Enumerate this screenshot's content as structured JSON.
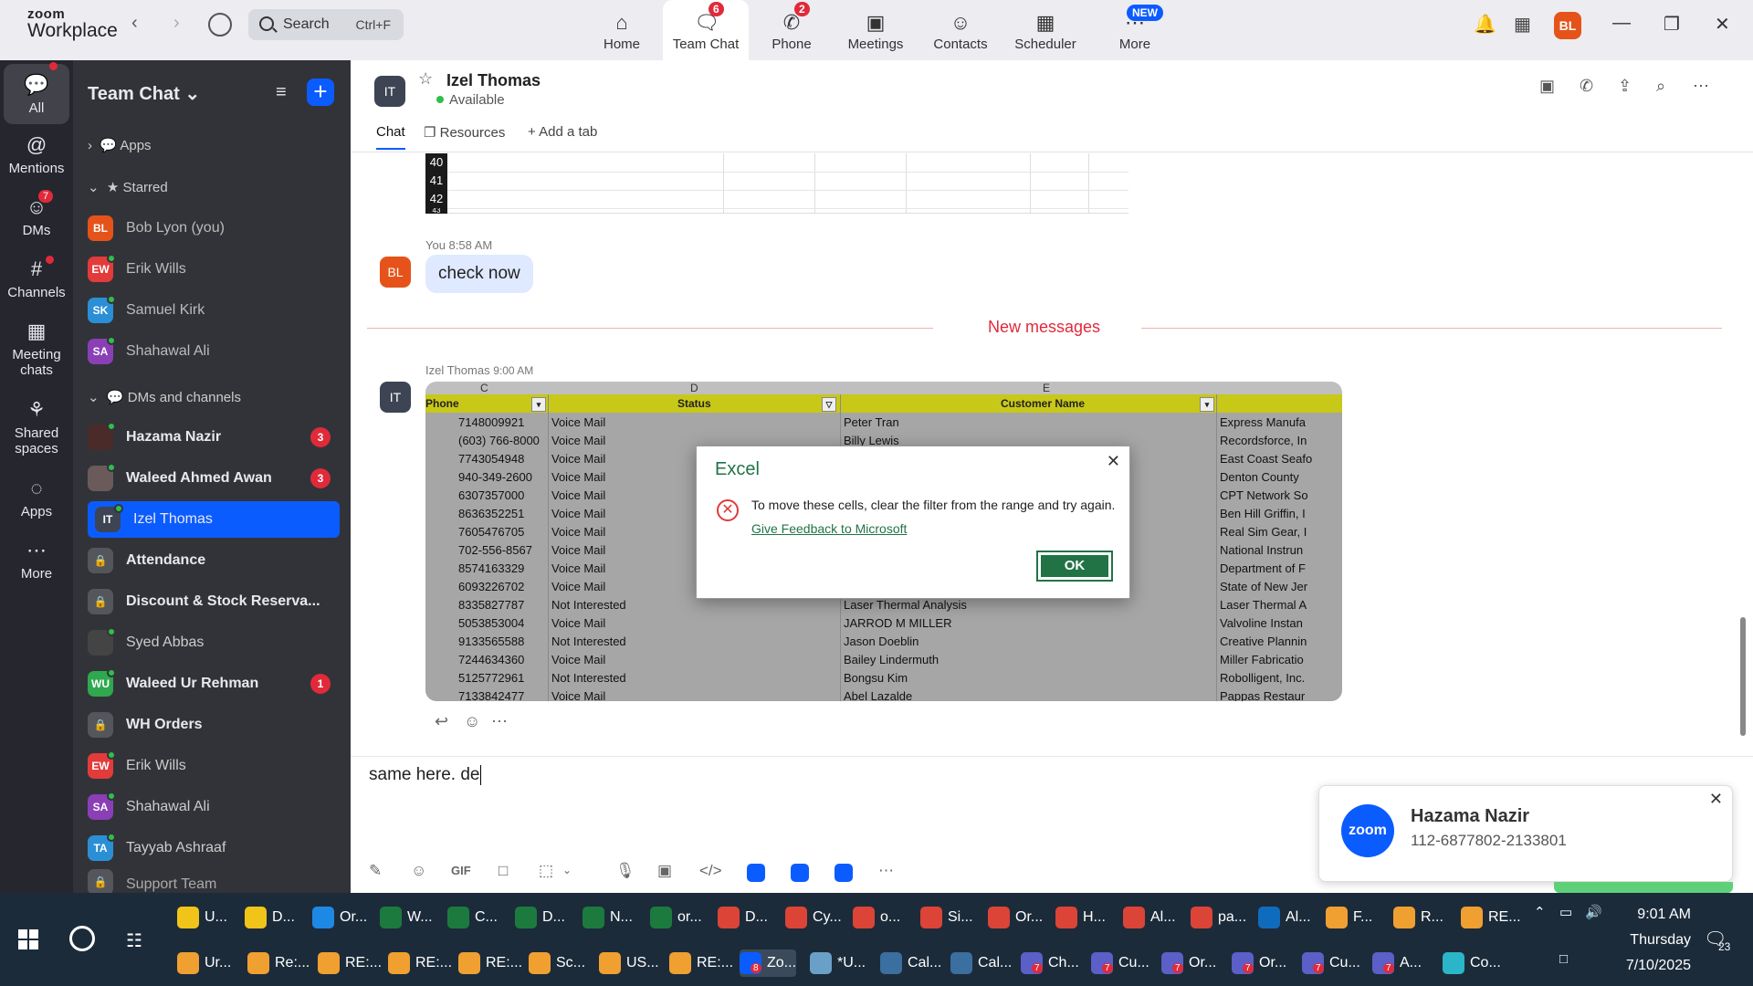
{
  "topbar": {
    "logo_top": "zoom",
    "logo_bottom": "Workplace",
    "search_label": "Search",
    "search_shortcut": "Ctrl+F",
    "tabs": [
      {
        "label": "Home",
        "icon": "home-icon",
        "badge": ""
      },
      {
        "label": "Team Chat",
        "icon": "team-chat-icon",
        "badge": "6"
      },
      {
        "label": "Phone",
        "icon": "phone-icon",
        "badge": "2"
      },
      {
        "label": "Meetings",
        "icon": "video-icon",
        "badge": ""
      },
      {
        "label": "Contacts",
        "icon": "contacts-icon",
        "badge": ""
      },
      {
        "label": "Scheduler",
        "icon": "calendar-icon",
        "badge": ""
      },
      {
        "label": "More",
        "icon": "more-icon",
        "badge": "NEW"
      }
    ],
    "avatar": "BL"
  },
  "rail": [
    {
      "label": "All",
      "icon": "chat-icon",
      "badge": ""
    },
    {
      "label": "Mentions",
      "icon": "at-icon",
      "badge": ""
    },
    {
      "label": "DMs",
      "icon": "dms-icon",
      "badge": "7"
    },
    {
      "label": "Channels",
      "icon": "hash-icon",
      "badge": ""
    },
    {
      "label": "Meeting",
      "label2": "chats",
      "icon": "calendar-icon",
      "badge": ""
    },
    {
      "label": "Shared",
      "label2": "spaces",
      "icon": "shared-icon",
      "badge": ""
    },
    {
      "label": "Apps",
      "icon": "apps-icon",
      "badge": ""
    },
    {
      "label": "More",
      "icon": "more-icon",
      "badge": ""
    }
  ],
  "sidebar": {
    "title": "Team Chat",
    "apps": "Apps",
    "starred": "Starred",
    "dms_section": "DMs and channels",
    "starred_items": [
      {
        "initials": "BL",
        "name": "Bob Lyon (you)",
        "color": "#e5531a"
      },
      {
        "initials": "EW",
        "name": "Erik Wills",
        "color": "#e23b3b"
      },
      {
        "initials": "SK",
        "name": "Samuel Kirk",
        "color": "#2b8fd6"
      },
      {
        "initials": "SA",
        "name": "Shahawal Ali",
        "color": "#8a3fb5"
      }
    ],
    "dm_items": [
      {
        "initials": "",
        "name": "Hazama Nazir",
        "color": "#4b2a2a",
        "bold": true,
        "count": "3"
      },
      {
        "initials": "",
        "name": "Waleed Ahmed Awan",
        "color": "#6a5a5a",
        "bold": true,
        "count": "3"
      },
      {
        "initials": "IT",
        "name": "Izel Thomas",
        "color": "#3d4453",
        "bold": false,
        "count": "",
        "selected": true
      },
      {
        "initials": "",
        "name": "Attendance",
        "color": "#55565c",
        "bold": true,
        "count": "",
        "lock": true
      },
      {
        "initials": "",
        "name": "Discount & Stock Reserva...",
        "color": "#55565c",
        "bold": true,
        "count": "",
        "lock": true
      },
      {
        "initials": "",
        "name": "Syed Abbas",
        "color": "#444",
        "bold": false,
        "count": ""
      },
      {
        "initials": "WU",
        "name": "Waleed Ur Rehman",
        "color": "#2fa84f",
        "bold": true,
        "count": "1"
      },
      {
        "initials": "",
        "name": "WH Orders",
        "color": "#55565c",
        "bold": true,
        "count": "",
        "lock": true
      },
      {
        "initials": "EW",
        "name": "Erik Wills",
        "color": "#e23b3b",
        "bold": false,
        "count": ""
      },
      {
        "initials": "SA",
        "name": "Shahawal Ali",
        "color": "#8a3fb5",
        "bold": false,
        "count": ""
      },
      {
        "initials": "TA",
        "name": "Tayyab Ashraaf",
        "color": "#2b8fd6",
        "bold": false,
        "count": ""
      },
      {
        "initials": "",
        "name": "Support Team",
        "color": "#55565c",
        "bold": false,
        "count": "",
        "lock": true
      }
    ]
  },
  "chat_header": {
    "initials": "IT",
    "name": "Izel Thomas",
    "status": "Available",
    "tabs": [
      "Chat",
      "Resources",
      "+ Add a tab"
    ]
  },
  "sheet_strip_rows": [
    "40",
    "41",
    "42",
    "43"
  ],
  "messages": {
    "you_meta": "You 8:58 AM",
    "you_initials": "BL",
    "you_text": "check now",
    "new_messages": "New messages",
    "izel_meta": "Izel Thomas",
    "izel_time": "9:00 AM",
    "izel_initials": "IT"
  },
  "excel_image": {
    "col_letters": [
      "C",
      "D",
      "E"
    ],
    "headers": [
      "Phone",
      "Status",
      "Customer Name"
    ],
    "rows": [
      [
        "7148009921",
        "Voice Mail",
        "Peter Tran",
        "Express Manufa"
      ],
      [
        "(603) 766-8000",
        "Voice Mail",
        "Billy Lewis",
        "Recordsforce, In"
      ],
      [
        "7743054948",
        "Voice Mail",
        "",
        "East Coast Seafo"
      ],
      [
        "940-349-2600",
        "Voice Mail",
        "",
        "Denton County"
      ],
      [
        "6307357000",
        "Voice Mail",
        "",
        "CPT Network So"
      ],
      [
        "8636352251",
        "Voice Mail",
        "",
        "Ben Hill Griffin, I"
      ],
      [
        "7605476705",
        "Voice Mail",
        "",
        "Real Sim Gear, I"
      ],
      [
        "702-556-8567",
        "Voice Mail",
        "",
        "National Instrun"
      ],
      [
        "8574163329",
        "Voice Mail",
        "",
        "Department of F"
      ],
      [
        "6093226702",
        "Voice Mail",
        "",
        "State of New Jer"
      ],
      [
        "8335827787",
        "Not Interested",
        "Laser Thermal Analysis",
        "Laser Thermal A"
      ],
      [
        "5053853004",
        "Voice Mail",
        "JARROD M MILLER",
        "Valvoline Instan"
      ],
      [
        "9133565588",
        "Not Interested",
        "Jason Doeblin",
        "Creative Plannin"
      ],
      [
        "7244634360",
        "Voice Mail",
        "Bailey Lindermuth",
        "Miller Fabricatio"
      ],
      [
        "5125772961",
        "Not Interested",
        "Bongsu Kim",
        "Robolligent, Inc."
      ],
      [
        "7133842477",
        "Voice Mail",
        "Abel Lazalde",
        "Pappas Restaur"
      ]
    ]
  },
  "dialog": {
    "title": "Excel",
    "message": "To move these cells, clear the filter from the range and try again.",
    "feedback": "Give Feedback to Microsoft",
    "ok": "OK"
  },
  "compose": {
    "text": "same here. de"
  },
  "toast": {
    "logo": "zoom",
    "name": "Hazama Nazir",
    "number": "112-6877802-2133801"
  },
  "taskbar": {
    "row1": [
      {
        "label": "U...",
        "color": "#f0c419"
      },
      {
        "label": "D...",
        "color": "#f0c419"
      },
      {
        "label": "Or...",
        "color": "#1e88e5"
      },
      {
        "label": "W...",
        "color": "#1d7a3e"
      },
      {
        "label": "C...",
        "color": "#1d7a3e"
      },
      {
        "label": "D...",
        "color": "#1d7a3e"
      },
      {
        "label": "N...",
        "color": "#1d7a3e"
      },
      {
        "label": "or...",
        "color": "#1d7a3e"
      },
      {
        "label": "D...",
        "color": "#db4437"
      },
      {
        "label": "Cy...",
        "color": "#db4437"
      },
      {
        "label": "o...",
        "color": "#db4437"
      },
      {
        "label": "Si...",
        "color": "#db4437"
      },
      {
        "label": "Or...",
        "color": "#db4437"
      },
      {
        "label": "H...",
        "color": "#db4437"
      },
      {
        "label": "Al...",
        "color": "#db4437"
      },
      {
        "label": "pa...",
        "color": "#db4437"
      },
      {
        "label": "Al...",
        "color": "#0f6cbd"
      },
      {
        "label": "F...",
        "color": "#f0a030"
      },
      {
        "label": "R...",
        "color": "#f0a030"
      },
      {
        "label": "RE...",
        "color": "#f0a030"
      }
    ],
    "row2": [
      {
        "label": "Ur...",
        "color": "#f0a030"
      },
      {
        "label": "Re:...",
        "color": "#f0a030"
      },
      {
        "label": "RE:...",
        "color": "#f0a030"
      },
      {
        "label": "RE:...",
        "color": "#f0a030"
      },
      {
        "label": "RE:...",
        "color": "#f0a030"
      },
      {
        "label": "Sc...",
        "color": "#f0a030"
      },
      {
        "label": "US...",
        "color": "#f0a030"
      },
      {
        "label": "RE:...",
        "color": "#f0a030"
      },
      {
        "label": "Zo...",
        "color": "#0b5cff",
        "badge": "8"
      },
      {
        "label": "*U...",
        "color": "#6aa0c8"
      },
      {
        "label": "Cal...",
        "color": "#3a6f9f"
      },
      {
        "label": "Cal...",
        "color": "#3a6f9f"
      },
      {
        "label": "Ch...",
        "color": "#5b5fc7",
        "badge": "7"
      },
      {
        "label": "Cu...",
        "color": "#5b5fc7",
        "badge": "7"
      },
      {
        "label": "Or...",
        "color": "#5b5fc7",
        "badge": "7"
      },
      {
        "label": "Or...",
        "color": "#5b5fc7",
        "badge": "7"
      },
      {
        "label": "Cu...",
        "color": "#5b5fc7",
        "badge": "7"
      },
      {
        "label": "A...",
        "color": "#5b5fc7",
        "badge": "7"
      },
      {
        "label": "Co...",
        "color": "#2bb5c8"
      }
    ],
    "time": "9:01 AM",
    "day": "Thursday",
    "date": "7/10/2025",
    "notif_count": "23"
  }
}
